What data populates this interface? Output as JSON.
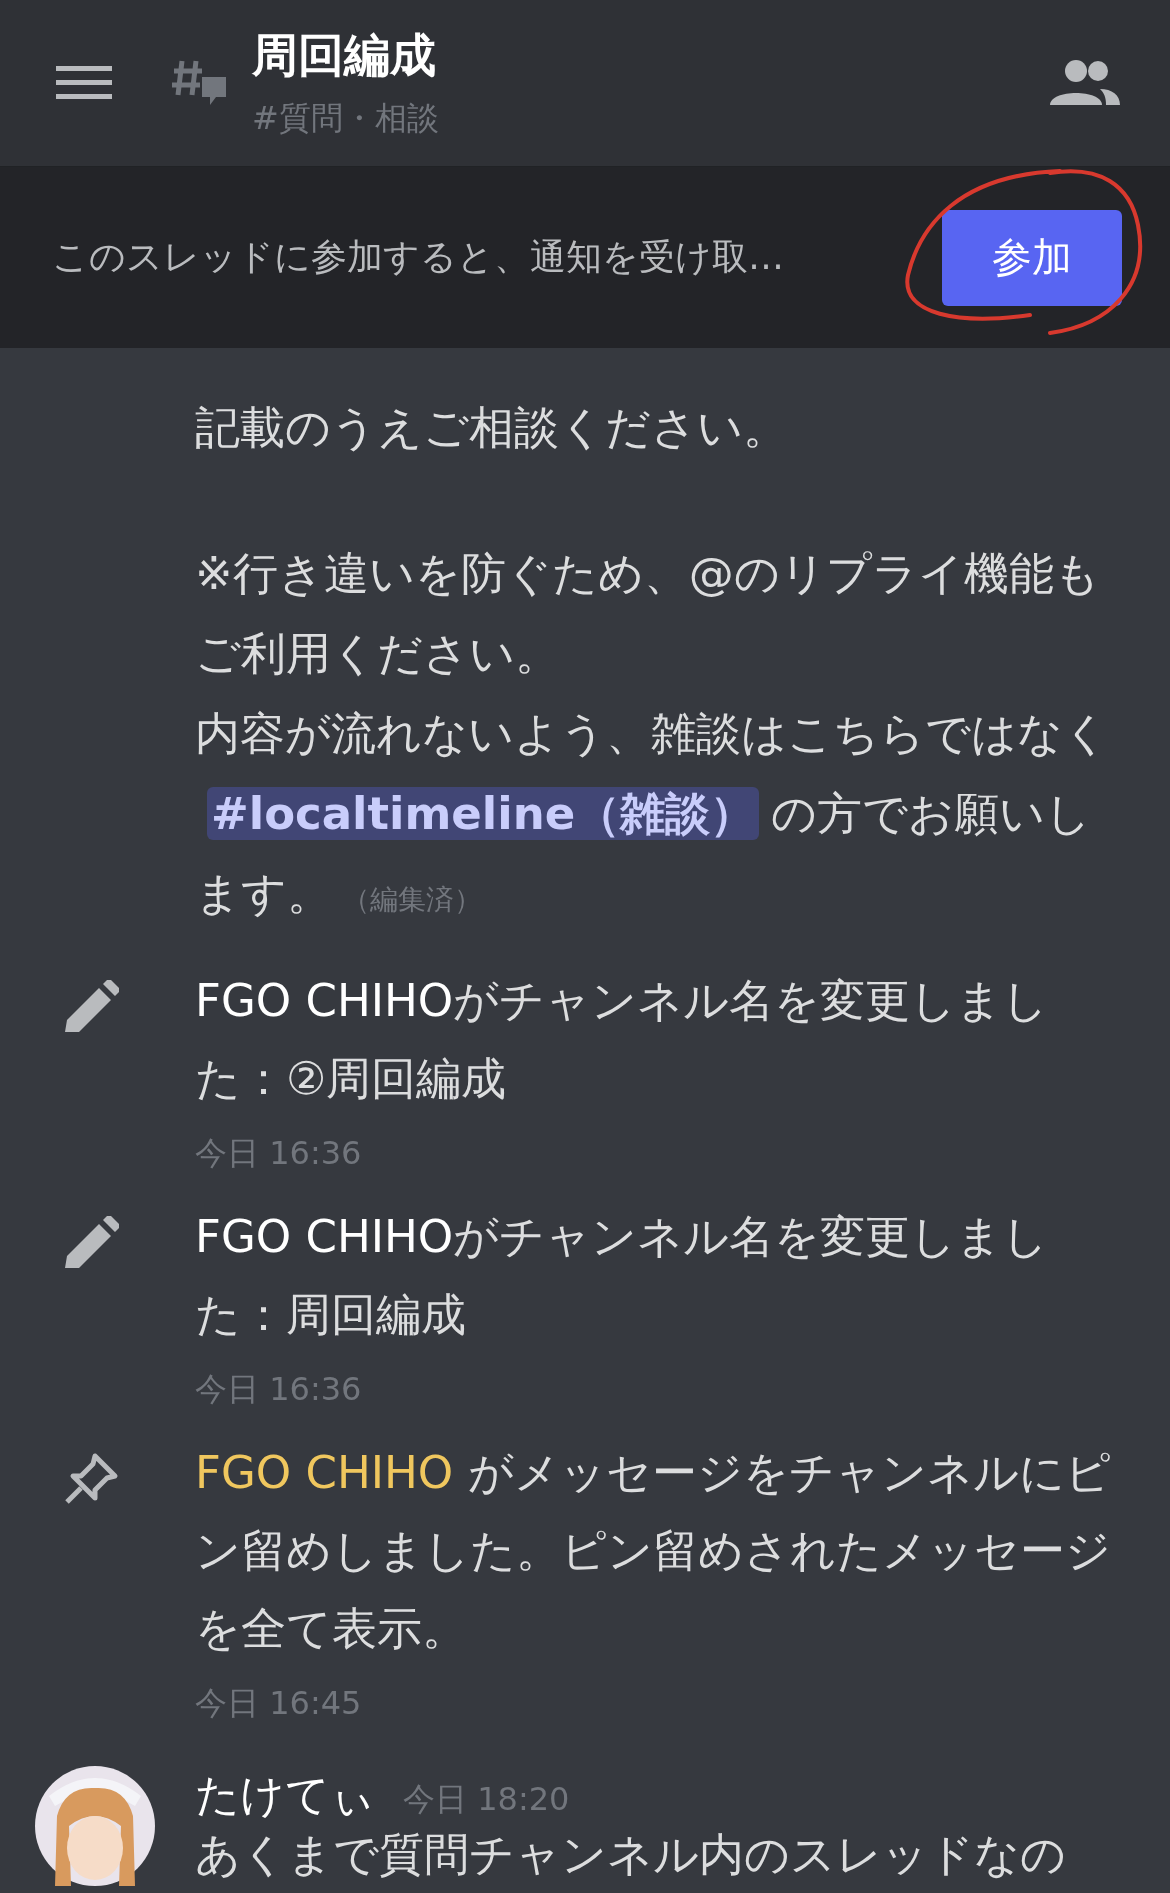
{
  "header": {
    "title": "周回編成",
    "subtitle": "#質問・相談"
  },
  "banner": {
    "text": "このスレッドに参加すると、通知を受け取…",
    "button": "参加"
  },
  "intro": [
    {
      "text": "記載のうえご相談ください。"
    },
    {
      "text": "※行き違いを防ぐため、@のリプライ機能もご利用ください。"
    },
    {
      "text": "内容が流れないよう、雑談はこちらではなく",
      "mention": "#localtimeline（雑談）",
      "after": "の方でお願いします。",
      "edited": "（編集済）"
    }
  ],
  "messages": [
    {
      "kind": "rename",
      "author": "FGO CHIHO",
      "text": "がチャンネル名を変更しました：②周回編成",
      "time": "今日 16:36"
    },
    {
      "kind": "rename",
      "author": "FGO CHIHO",
      "text": "がチャンネル名を変更しました：周回編成",
      "time": "今日 16:36"
    },
    {
      "kind": "pin",
      "author": "FGO CHIHO",
      "color": "#f0c75e",
      "text": " がメッセージをチャンネルにピン留めしました。ピン留めされたメッセージを全て表示。",
      "time": "今日 16:45"
    },
    {
      "kind": "user",
      "author": "たけてぃ",
      "time": "今日 18:20",
      "text": "あくまで質問チャンネル内のスレッドなの"
    }
  ]
}
